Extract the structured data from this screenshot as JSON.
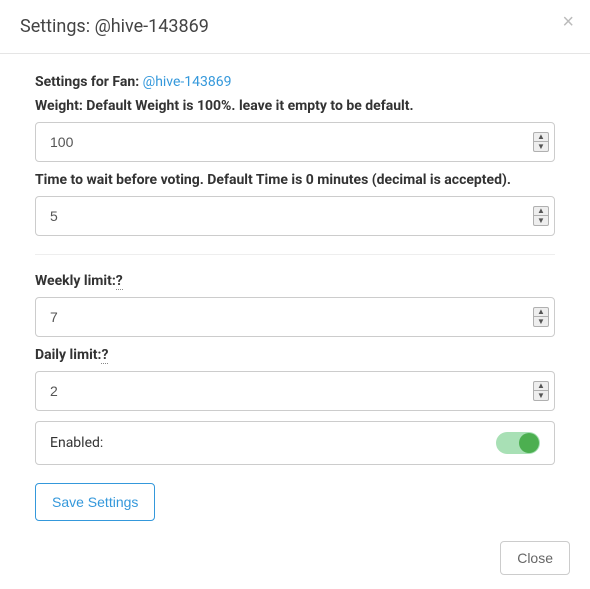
{
  "header": {
    "title_prefix": "Settings: ",
    "account": "@hive-143869"
  },
  "intro": {
    "prefix": "Settings for Fan: ",
    "account_link": "@hive-143869"
  },
  "fields": {
    "weight": {
      "label": "Weight: Default Weight is 100%. leave it empty to be default.",
      "value": "100"
    },
    "time": {
      "label": "Time to wait before voting. Default Time is 0 minutes (decimal is accepted).",
      "value": "5"
    },
    "weekly": {
      "label": "Weekly limit:",
      "help": "?",
      "value": "7"
    },
    "daily": {
      "label": "Daily limit:",
      "help": "?",
      "value": "2"
    },
    "enabled": {
      "label": "Enabled:",
      "on": true
    }
  },
  "actions": {
    "save": "Save Settings",
    "close": "Close"
  }
}
